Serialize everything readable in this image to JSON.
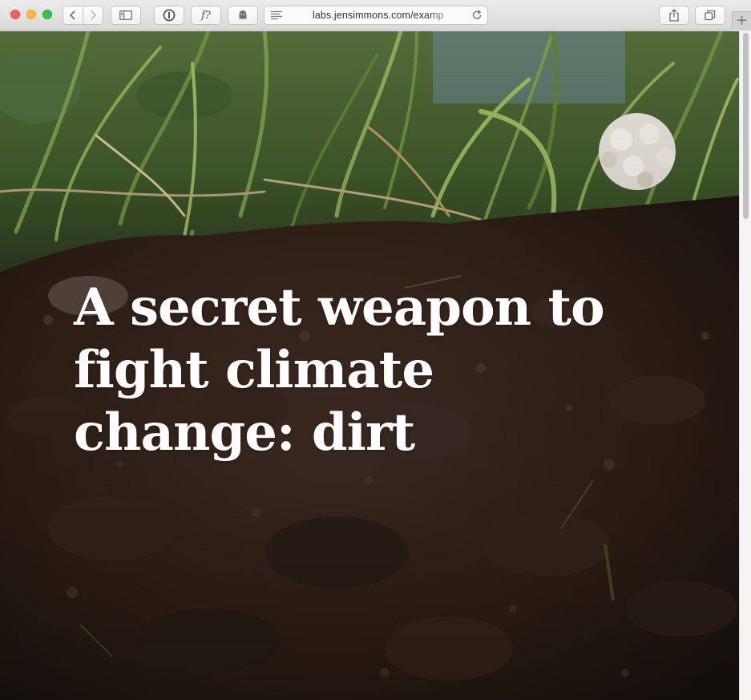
{
  "browser": {
    "url": "labs.jensimmons.com/examp",
    "fonts_button_label": "f?",
    "new_tab_label": "+",
    "icons": {
      "back": "chevron-left-icon",
      "forward": "chevron-right-icon",
      "sidebar": "sidebar-icon",
      "password": "1password-icon",
      "ghost": "ghostery-icon",
      "reader": "reader-icon",
      "reload": "reload-icon",
      "share": "share-icon",
      "tabs": "tab-overview-icon"
    }
  },
  "page": {
    "headline": "A secret weapon to fight climate change: dirt"
  },
  "colors": {
    "headline": "#ffffff",
    "soil": "#2b1f19",
    "close": "#fc605c",
    "minimize": "#fdbc40",
    "maximize": "#34c84a"
  }
}
